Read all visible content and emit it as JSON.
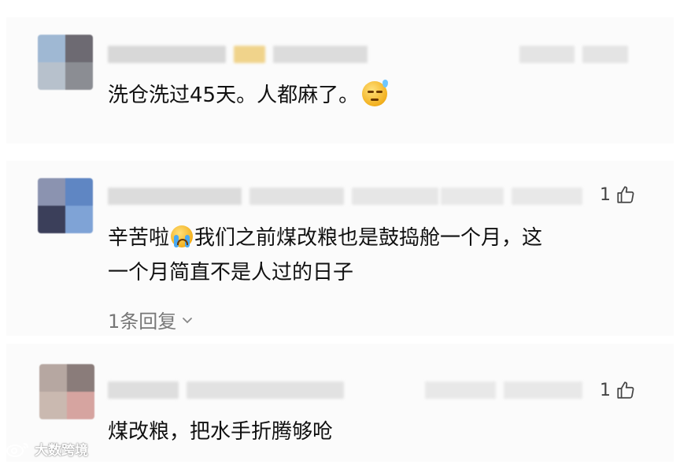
{
  "comments": [
    {
      "text": "洗仓洗过45天。人都麻了。",
      "emoji": "sweat-smile-emoji"
    },
    {
      "text_before_emoji": "辛苦啦",
      "emoji": "crying-emoji",
      "text_after_emoji": "我们之前煤改粮也是鼓捣舱一个月，这",
      "text_line2": "一个月简直不是人过的日子",
      "like_count": "1",
      "replies_label": "1条回复"
    },
    {
      "text": "煤改粮，把水手折腾够呛",
      "like_count": "1"
    }
  ],
  "watermark": {
    "text": "大数跨境"
  },
  "colors": {
    "page_bg": "#ffffff",
    "card_bg": "#fbfbfb",
    "text": "#111111",
    "muted": "#777777"
  },
  "icons": [
    "thumbs-up-icon",
    "chevron-down-icon",
    "weibo-watermark-icon"
  ]
}
